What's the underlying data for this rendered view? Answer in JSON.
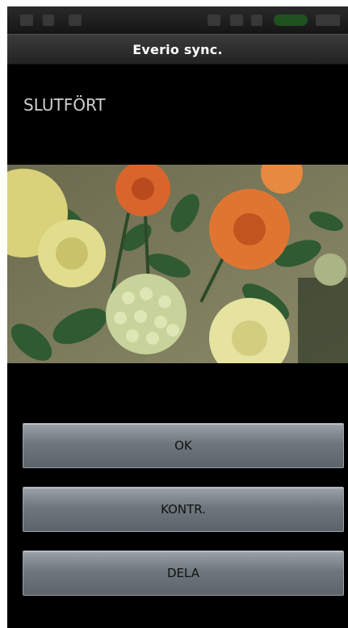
{
  "app": {
    "title": "Everio sync."
  },
  "status": {
    "text": "SLUTFÖRT"
  },
  "buttons": {
    "ok": "OK",
    "kontr": "KONTR.",
    "dela": "DELA"
  },
  "photo": {
    "icon": "flower-photo"
  },
  "colors": {
    "background": "#000000",
    "button": "#6f777e",
    "title_text": "#ffffff"
  }
}
